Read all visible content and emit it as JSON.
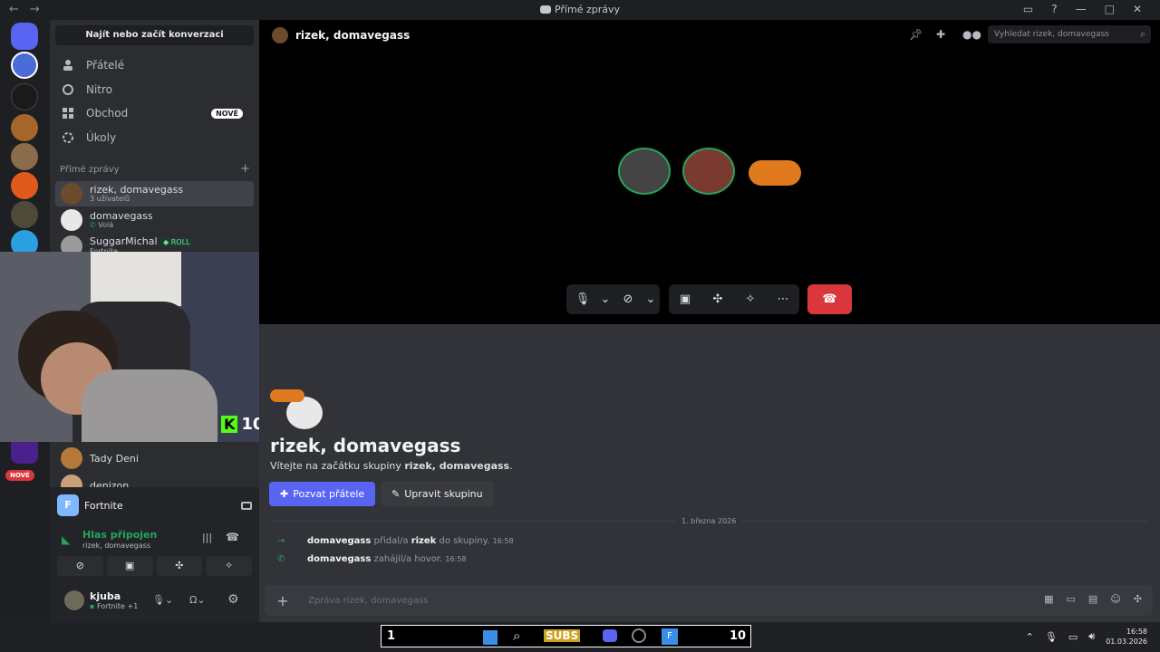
{
  "titlebar": {
    "back": "←",
    "forward": "→",
    "title": "Přímé zprávy"
  },
  "sidebar": {
    "search": "Najít nebo začít konverzaci",
    "nav": [
      {
        "label": "Přátelé",
        "icon": "friends-icon"
      },
      {
        "label": "Nitro",
        "icon": "nitro-icon"
      },
      {
        "label": "Obchod",
        "icon": "shop-icon",
        "badge": "NOVÉ"
      },
      {
        "label": "Úkoly",
        "icon": "quests-icon"
      }
    ],
    "dm_header": "Přímé zprávy",
    "dm_add": "+",
    "dms": [
      {
        "name": "rizek, domavegass",
        "sub": "3 uživatelů"
      },
      {
        "name": "domavegass",
        "sub": "Volá"
      },
      {
        "name": "SuggarMichal",
        "badge": "ROLL",
        "sub": "Fortnite"
      },
      {
        "name": "Tady Deni",
        "sub": ""
      },
      {
        "name": "denizon",
        "sub": ""
      }
    ],
    "server_new_badge": "NOVÉ",
    "activity": {
      "game": "Fortnite"
    },
    "voice": {
      "status": "Hlas připojen",
      "channel": "rizek, domavegass"
    },
    "user": {
      "name": "kjuba",
      "status": "Fortnite +1"
    }
  },
  "webcam": {
    "overlay_letter": "K",
    "overlay_number": "10"
  },
  "main": {
    "header_title": "rizek, domavegass",
    "search_placeholder": "Vyhledat rizek, domavegass",
    "welcome_title": "rizek, domavegass",
    "welcome_prefix": "Vítejte na začátku skupiny ",
    "welcome_name": "rizek, domavegass",
    "welcome_suffix": ".",
    "invite_button": "Pozvat přátele",
    "edit_button": "Upravit skupinu",
    "date_divider": "1. března 2026",
    "messages": [
      {
        "user": "domavegass",
        "action": "přidal/a",
        "target": "rizek",
        "rest": "do skupiny.",
        "time": "16:58"
      },
      {
        "user": "domavegass",
        "action": "zahájil/a hovor.",
        "time": "16:58"
      }
    ],
    "composer_placeholder": "Zpráva rizek, domavegass"
  },
  "taskbar": {
    "left_number": "1",
    "subs": "SUBS",
    "right_number": "10",
    "time": "16:58",
    "date": "01.03.2026"
  },
  "colors": {
    "accent": "#5865f2",
    "hangup": "#da373c",
    "green": "#23a55a"
  }
}
